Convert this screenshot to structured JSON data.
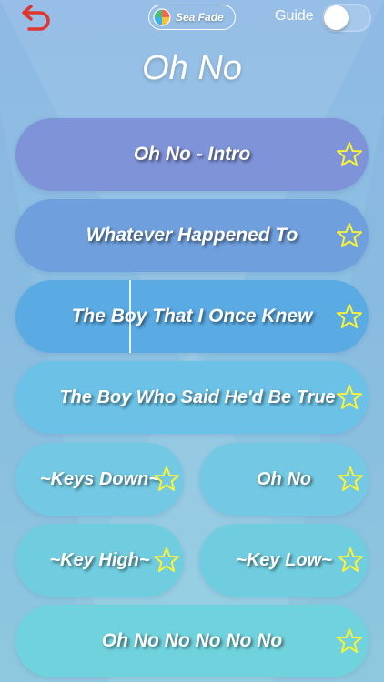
{
  "header": {
    "theme_label": "Sea Fade",
    "guide_label": "Guide",
    "guide_on": false
  },
  "title": "Oh No",
  "pads": [
    {
      "label": "Oh No - Intro",
      "color": "#7f93d9"
    },
    {
      "label": "Whatever Happened To",
      "color": "#6f9fdd"
    },
    {
      "label": "The Boy That I Once Knew",
      "color": "#5aaae3"
    },
    {
      "label": "The Boy Who Said He'd Be True",
      "color": "#6bc2e6"
    },
    {
      "label": "~Keys Down~",
      "color": "#73c9e3"
    },
    {
      "label": "Oh No",
      "color": "#73c9e3"
    },
    {
      "label": "~Key High~",
      "color": "#70cddf"
    },
    {
      "label": "~Key Low~",
      "color": "#70cddf"
    },
    {
      "label": "Oh No No No No No",
      "color": "#6fd2dd"
    }
  ],
  "colors": {
    "back_arrow": "#e0352e",
    "star": "#f7f23a"
  },
  "icons": {
    "back": "undo-arrow-icon",
    "theme": "color-wheel-icon",
    "favorite": "star-outline-icon"
  }
}
